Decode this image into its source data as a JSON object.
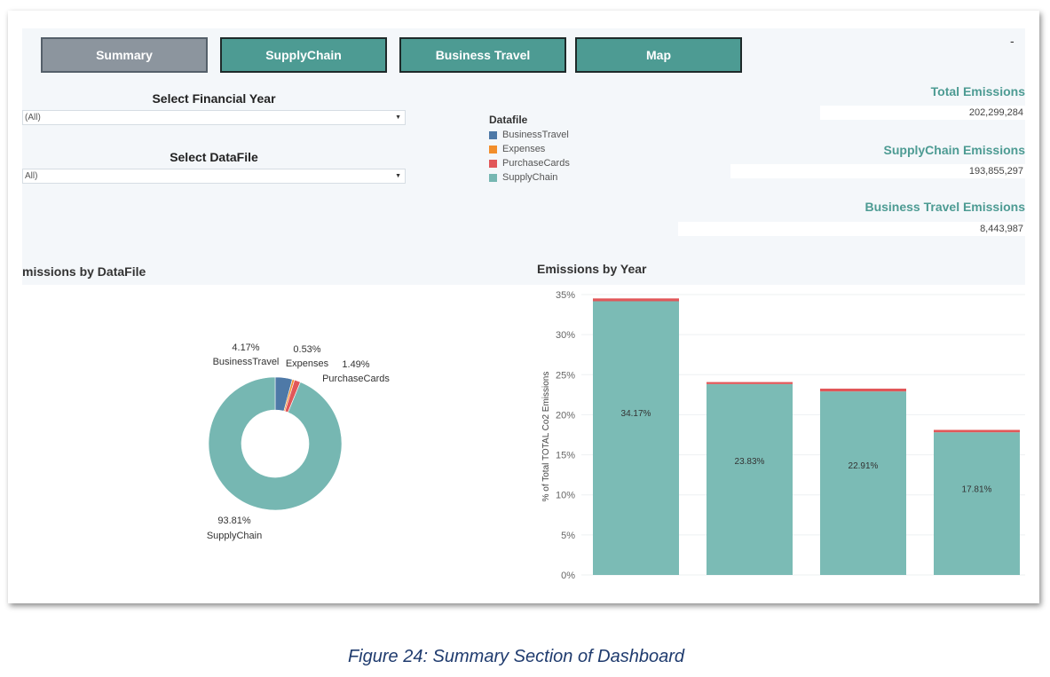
{
  "nav": {
    "tabs": [
      {
        "label": "Summary",
        "active": true
      },
      {
        "label": "SupplyChain",
        "active": false
      },
      {
        "label": "Business Travel",
        "active": false
      },
      {
        "label": "Map",
        "active": false
      }
    ]
  },
  "corner_mark": "-",
  "filters": {
    "year_title": "Select Financial Year",
    "year_value": "(All)",
    "datafile_title": "Select DataFile",
    "datafile_value": "All)"
  },
  "legend": {
    "title": "Datafile",
    "items": [
      {
        "label": "BusinessTravel",
        "color": "#4e79a7"
      },
      {
        "label": "Expenses",
        "color": "#f28e2b"
      },
      {
        "label": "PurchaseCards",
        "color": "#e15759"
      },
      {
        "label": "SupplyChain",
        "color": "#76b7b2"
      }
    ]
  },
  "kpis": {
    "total_title": "Total Emissions",
    "total_value": "202,299,284",
    "supply_title": "SupplyChain Emissions",
    "supply_value": "193,855,297",
    "travel_title": "Business Travel Emissions",
    "travel_value": "8,443,987"
  },
  "donut": {
    "title": "missions by DataFile"
  },
  "bars": {
    "title": "Emissions by Year"
  },
  "caption": "Figure 24: Summary Section of Dashboard",
  "chart_data": [
    {
      "type": "pie",
      "title": "missions by DataFile",
      "slices": [
        {
          "label": "BusinessTravel",
          "pct_text": "4.17%",
          "value": 4.17,
          "color": "#4e79a7"
        },
        {
          "label": "Expenses",
          "pct_text": "0.53%",
          "value": 0.53,
          "color": "#f28e2b"
        },
        {
          "label": "PurchaseCards",
          "pct_text": "1.49%",
          "value": 1.49,
          "color": "#e15759"
        },
        {
          "label": "SupplyChain",
          "pct_text": "93.81%",
          "value": 93.81,
          "color": "#76b7b2"
        }
      ]
    },
    {
      "type": "bar",
      "title": "Emissions by Year",
      "ylabel": "% of Total TOTAL Co2 Emissions",
      "ylim": [
        0,
        35
      ],
      "yticks": [
        "0%",
        "5%",
        "10%",
        "15%",
        "20%",
        "25%",
        "30%",
        "35%"
      ],
      "yticks_values": [
        0,
        5,
        10,
        15,
        20,
        25,
        30,
        35
      ],
      "grid": true,
      "series": [
        {
          "values": [
            34.17,
            23.83,
            22.91,
            17.81
          ],
          "labels": [
            "34.17%",
            "23.83%",
            "22.91%",
            "17.81%"
          ],
          "color": "#7bbbb5"
        },
        {
          "values": [
            0.35,
            0.25,
            0.35,
            0.3
          ],
          "color": "#e15759"
        }
      ]
    }
  ]
}
